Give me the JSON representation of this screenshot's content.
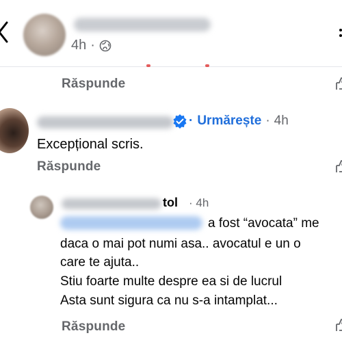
{
  "header": {
    "time": "4h",
    "separator": "·"
  },
  "comments": [
    {
      "reply_label": "Răspunde"
    },
    {
      "follow_label": "Urmărește",
      "separator": "·",
      "time": "4h",
      "text": "Excepțional scris.",
      "reply_label": "Răspunde"
    },
    {
      "name_tail": "tol",
      "separator": "·",
      "time": "4h",
      "lines": [
        "a fost “avocata” me",
        "daca o mai pot numi asa.. avocatul e un o",
        "care te ajuta..",
        "Stiu foarte multe despre ea si de lucrul",
        "Asta sunt sigura ca nu s-a intamplat..."
      ],
      "reply_label": "Răspunde"
    }
  ],
  "colors": {
    "link_blue": "#216fdb",
    "meta_gray": "#65676b",
    "text": "#050505"
  }
}
